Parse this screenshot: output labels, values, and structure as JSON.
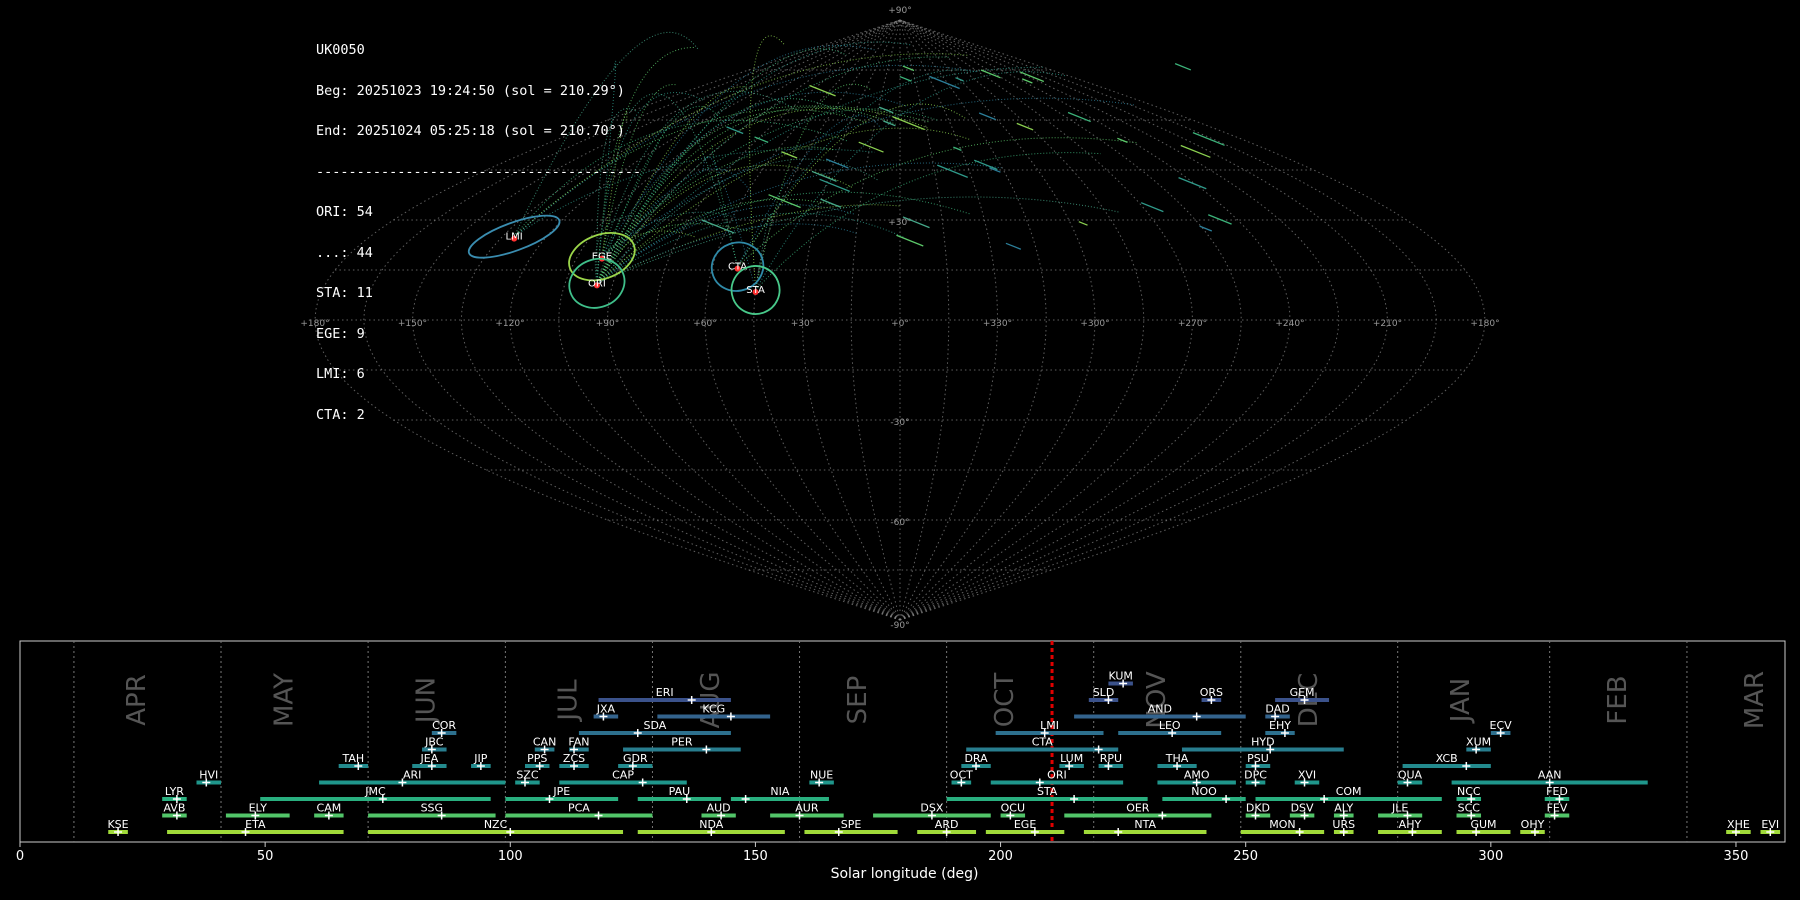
{
  "info": {
    "station": "UK0050",
    "begin": "Beg: 20251023 19:24:50 (sol = 210.29°)",
    "end": "End: 20251024 05:25:18 (sol = 210.70°)",
    "separator": "----------------------------------------",
    "counts": [
      "ORI: 54",
      "...: 44",
      "STA: 11",
      "EGE: 9",
      "LMI: 6",
      "CTA: 2"
    ]
  },
  "colors": {
    "background": "#000000",
    "grid": "#888888",
    "solar_marker": "#e00000",
    "text": "#ffffff",
    "month_label": "#555555"
  },
  "sky_map": {
    "projection": "sinusoidal",
    "lon_labels": [
      "+180°",
      "+150°",
      "+120°",
      "+90°",
      "+60°",
      "+30°",
      "+0°",
      "+330°",
      "+300°",
      "+270°",
      "+240°",
      "+210°",
      "+180°"
    ],
    "lat_labels": [
      "+90°",
      "+30°",
      "-30°",
      "-60°",
      "-90°"
    ],
    "radiants": [
      {
        "code": "LMI",
        "lon": 131,
        "lat": 25,
        "color": "#3a8db0",
        "a": 48,
        "b": 14
      },
      {
        "code": "EGE",
        "lon": 97,
        "lat": 19,
        "color": "#9bd64a",
        "a": 34,
        "b": 22
      },
      {
        "code": "ORI",
        "lon": 95,
        "lat": 11,
        "color": "#3fbf8a",
        "a": 28,
        "b": 24
      },
      {
        "code": "CTA",
        "lon": 52,
        "lat": 16,
        "color": "#2f8aa8",
        "a": 26,
        "b": 24
      },
      {
        "code": "STA",
        "lon": 45,
        "lat": 9,
        "color": "#48c98a",
        "a": 24,
        "b": 24
      }
    ]
  },
  "chart_data": {
    "type": "range-timeline",
    "xlabel": "Solar longitude (deg)",
    "xlim": [
      0,
      360
    ],
    "xticks": [
      "0",
      "50",
      "100",
      "150",
      "200",
      "250",
      "300",
      "350"
    ],
    "current_sol": 210.5,
    "months": [
      {
        "label": "APR",
        "pos": 24
      },
      {
        "label": "MAY",
        "pos": 54
      },
      {
        "label": "JUN",
        "pos": 83
      },
      {
        "label": "JUL",
        "pos": 112
      },
      {
        "label": "AUG",
        "pos": 141
      },
      {
        "label": "SEP",
        "pos": 171
      },
      {
        "label": "OCT",
        "pos": 201
      },
      {
        "label": "NOV",
        "pos": 232
      },
      {
        "label": "DEC",
        "pos": 263
      },
      {
        "label": "JAN",
        "pos": 294
      },
      {
        "label": "FEB",
        "pos": 326
      },
      {
        "label": "MAR",
        "pos": 354
      }
    ],
    "month_boundaries": [
      11,
      41,
      71,
      99,
      129,
      159,
      189,
      219,
      249,
      281,
      312,
      340
    ],
    "showers": [
      {
        "code": "KUM",
        "start": 222,
        "end": 227,
        "peak": 225,
        "row": 9,
        "color": "#3b528b"
      },
      {
        "code": "ERI",
        "start": 118,
        "end": 145,
        "peak": 137,
        "row": 8,
        "color": "#3b528b"
      },
      {
        "code": "SLD",
        "start": 218,
        "end": 224,
        "peak": 222,
        "row": 8,
        "color": "#3b528b"
      },
      {
        "code": "ORS",
        "start": 241,
        "end": 245,
        "peak": 243,
        "row": 8,
        "color": "#3b528b"
      },
      {
        "code": "GEM",
        "start": 256,
        "end": 267,
        "peak": 262,
        "row": 8,
        "color": "#3b528b"
      },
      {
        "code": "JXA",
        "start": 117,
        "end": 122,
        "peak": 119,
        "row": 7,
        "color": "#33638d"
      },
      {
        "code": "KCG",
        "start": 130,
        "end": 153,
        "peak": 145,
        "row": 7,
        "color": "#33638d"
      },
      {
        "code": "AND",
        "start": 215,
        "end": 250,
        "peak": 240,
        "row": 7,
        "color": "#33638d"
      },
      {
        "code": "DAD",
        "start": 254,
        "end": 259,
        "peak": 256,
        "row": 7,
        "color": "#33638d"
      },
      {
        "code": "COR",
        "start": 84,
        "end": 89,
        "peak": 86,
        "row": 6,
        "color": "#2d708e"
      },
      {
        "code": "SDA",
        "start": 114,
        "end": 145,
        "peak": 126,
        "row": 6,
        "color": "#2d708e"
      },
      {
        "code": "LMI",
        "start": 199,
        "end": 221,
        "peak": 209,
        "row": 6,
        "color": "#2d708e"
      },
      {
        "code": "LEO",
        "start": 224,
        "end": 245,
        "peak": 235,
        "row": 6,
        "color": "#2d708e"
      },
      {
        "code": "EHY",
        "start": 254,
        "end": 260,
        "peak": 258,
        "row": 6,
        "color": "#2d708e"
      },
      {
        "code": "ECV",
        "start": 300,
        "end": 304,
        "peak": 302,
        "row": 6,
        "color": "#2d708e"
      },
      {
        "code": "JBC",
        "start": 82,
        "end": 87,
        "peak": 84,
        "row": 5,
        "color": "#287d8e"
      },
      {
        "code": "CAN",
        "start": 105,
        "end": 109,
        "peak": 107,
        "row": 5,
        "color": "#287d8e"
      },
      {
        "code": "FAN",
        "start": 112,
        "end": 116,
        "peak": 113,
        "row": 5,
        "color": "#287d8e"
      },
      {
        "code": "PER",
        "start": 123,
        "end": 147,
        "peak": 140,
        "row": 5,
        "color": "#287d8e"
      },
      {
        "code": "CTA",
        "start": 193,
        "end": 224,
        "peak": 220,
        "row": 5,
        "color": "#287d8e"
      },
      {
        "code": "HYD",
        "start": 237,
        "end": 270,
        "peak": 255,
        "row": 5,
        "color": "#287d8e"
      },
      {
        "code": "XUM",
        "start": 295,
        "end": 300,
        "peak": 297,
        "row": 5,
        "color": "#287d8e"
      },
      {
        "code": "TAH",
        "start": 65,
        "end": 71,
        "peak": 69,
        "row": 4,
        "color": "#238a8d"
      },
      {
        "code": "JEA",
        "start": 80,
        "end": 87,
        "peak": 84,
        "row": 4,
        "color": "#238a8d"
      },
      {
        "code": "JIP",
        "start": 92,
        "end": 96,
        "peak": 94,
        "row": 4,
        "color": "#238a8d"
      },
      {
        "code": "PPS",
        "start": 103,
        "end": 108,
        "peak": 106,
        "row": 4,
        "color": "#238a8d"
      },
      {
        "code": "ZCS",
        "start": 110,
        "end": 116,
        "peak": 113,
        "row": 4,
        "color": "#238a8d"
      },
      {
        "code": "GDR",
        "start": 122,
        "end": 129,
        "peak": 125,
        "row": 4,
        "color": "#238a8d"
      },
      {
        "code": "DRA",
        "start": 192,
        "end": 198,
        "peak": 195,
        "row": 4,
        "color": "#238a8d"
      },
      {
        "code": "LUM",
        "start": 212,
        "end": 217,
        "peak": 214,
        "row": 4,
        "color": "#238a8d"
      },
      {
        "code": "RPU",
        "start": 220,
        "end": 225,
        "peak": 222,
        "row": 4,
        "color": "#238a8d"
      },
      {
        "code": "THA",
        "start": 232,
        "end": 240,
        "peak": 236,
        "row": 4,
        "color": "#238a8d"
      },
      {
        "code": "PSU",
        "start": 250,
        "end": 255,
        "peak": 252,
        "row": 4,
        "color": "#238a8d"
      },
      {
        "code": "XCB",
        "start": 282,
        "end": 300,
        "peak": 295,
        "row": 4,
        "color": "#238a8d"
      },
      {
        "code": "HVI",
        "start": 36,
        "end": 41,
        "peak": 38,
        "row": 3,
        "color": "#1f968b"
      },
      {
        "code": "ARI",
        "start": 61,
        "end": 99,
        "peak": 78,
        "row": 3,
        "color": "#1f968b"
      },
      {
        "code": "SZC",
        "start": 101,
        "end": 106,
        "peak": 103,
        "row": 3,
        "color": "#1f968b"
      },
      {
        "code": "CAP",
        "start": 110,
        "end": 136,
        "peak": 127,
        "row": 3,
        "color": "#1f968b"
      },
      {
        "code": "NUE",
        "start": 161,
        "end": 166,
        "peak": 163,
        "row": 3,
        "color": "#1f968b"
      },
      {
        "code": "OCT",
        "start": 190,
        "end": 194,
        "peak": 192,
        "row": 3,
        "color": "#1f968b"
      },
      {
        "code": "ORI",
        "start": 198,
        "end": 225,
        "peak": 208,
        "row": 3,
        "color": "#1f968b"
      },
      {
        "code": "AMO",
        "start": 232,
        "end": 248,
        "peak": 240,
        "row": 3,
        "color": "#1f968b"
      },
      {
        "code": "DPC",
        "start": 250,
        "end": 254,
        "peak": 252,
        "row": 3,
        "color": "#1f968b"
      },
      {
        "code": "XVI",
        "start": 260,
        "end": 265,
        "peak": 262,
        "row": 3,
        "color": "#1f968b"
      },
      {
        "code": "QUA",
        "start": 281,
        "end": 286,
        "peak": 283,
        "row": 3,
        "color": "#1f968b"
      },
      {
        "code": "AAN",
        "start": 292,
        "end": 332,
        "peak": 312,
        "row": 3,
        "color": "#1f968b"
      },
      {
        "code": "LYR",
        "start": 29,
        "end": 34,
        "peak": 32,
        "row": 2,
        "color": "#29af7f"
      },
      {
        "code": "JMC",
        "start": 49,
        "end": 96,
        "peak": 74,
        "row": 2,
        "color": "#29af7f"
      },
      {
        "code": "JPE",
        "start": 99,
        "end": 122,
        "peak": 108,
        "row": 2,
        "color": "#29af7f"
      },
      {
        "code": "PAU",
        "start": 126,
        "end": 143,
        "peak": 136,
        "row": 2,
        "color": "#29af7f"
      },
      {
        "code": "NIA",
        "start": 145,
        "end": 165,
        "peak": 148,
        "row": 2,
        "color": "#29af7f"
      },
      {
        "code": "STA",
        "start": 189,
        "end": 230,
        "peak": 215,
        "row": 2,
        "color": "#29af7f"
      },
      {
        "code": "NOO",
        "start": 233,
        "end": 250,
        "peak": 246,
        "row": 2,
        "color": "#29af7f"
      },
      {
        "code": "COM",
        "start": 252,
        "end": 290,
        "peak": 266,
        "row": 2,
        "color": "#29af7f"
      },
      {
        "code": "NCC",
        "start": 293,
        "end": 298,
        "peak": 296,
        "row": 2,
        "color": "#29af7f"
      },
      {
        "code": "FED",
        "start": 311,
        "end": 316,
        "peak": 314,
        "row": 2,
        "color": "#29af7f"
      },
      {
        "code": "AVB",
        "start": 29,
        "end": 34,
        "peak": 32,
        "row": 1,
        "color": "#52c569"
      },
      {
        "code": "ELY",
        "start": 42,
        "end": 55,
        "peak": 48,
        "row": 1,
        "color": "#52c569"
      },
      {
        "code": "CAM",
        "start": 60,
        "end": 66,
        "peak": 63,
        "row": 1,
        "color": "#52c569"
      },
      {
        "code": "SSG",
        "start": 71,
        "end": 97,
        "peak": 86,
        "row": 1,
        "color": "#52c569"
      },
      {
        "code": "PCA",
        "start": 99,
        "end": 129,
        "peak": 118,
        "row": 1,
        "color": "#52c569"
      },
      {
        "code": "AUD",
        "start": 139,
        "end": 146,
        "peak": 143,
        "row": 1,
        "color": "#52c569"
      },
      {
        "code": "AUR",
        "start": 153,
        "end": 168,
        "peak": 159,
        "row": 1,
        "color": "#52c569"
      },
      {
        "code": "DSX",
        "start": 174,
        "end": 198,
        "peak": 186,
        "row": 1,
        "color": "#52c569"
      },
      {
        "code": "OCU",
        "start": 200,
        "end": 205,
        "peak": 202,
        "row": 1,
        "color": "#52c569"
      },
      {
        "code": "OER",
        "start": 213,
        "end": 243,
        "peak": 233,
        "row": 1,
        "color": "#52c569"
      },
      {
        "code": "DKD",
        "start": 250,
        "end": 255,
        "peak": 252,
        "row": 1,
        "color": "#52c569"
      },
      {
        "code": "DSV",
        "start": 259,
        "end": 264,
        "peak": 262,
        "row": 1,
        "color": "#52c569"
      },
      {
        "code": "ALY",
        "start": 268,
        "end": 272,
        "peak": 270,
        "row": 1,
        "color": "#52c569"
      },
      {
        "code": "JLE",
        "start": 277,
        "end": 286,
        "peak": 283,
        "row": 1,
        "color": "#52c569"
      },
      {
        "code": "SCC",
        "start": 293,
        "end": 298,
        "peak": 296,
        "row": 1,
        "color": "#52c569"
      },
      {
        "code": "FEV",
        "start": 311,
        "end": 316,
        "peak": 313,
        "row": 1,
        "color": "#52c569"
      },
      {
        "code": "KSE",
        "start": 18,
        "end": 22,
        "peak": 20,
        "row": 0,
        "color": "#a0da39"
      },
      {
        "code": "ETA",
        "start": 30,
        "end": 66,
        "peak": 46,
        "row": 0,
        "color": "#a0da39"
      },
      {
        "code": "NZC",
        "start": 71,
        "end": 123,
        "peak": 100,
        "row": 0,
        "color": "#a0da39"
      },
      {
        "code": "NDA",
        "start": 126,
        "end": 156,
        "peak": 141,
        "row": 0,
        "color": "#a0da39"
      },
      {
        "code": "SPE",
        "start": 160,
        "end": 179,
        "peak": 167,
        "row": 0,
        "color": "#a0da39"
      },
      {
        "code": "ARD",
        "start": 183,
        "end": 195,
        "peak": 189,
        "row": 0,
        "color": "#a0da39"
      },
      {
        "code": "EGE",
        "start": 197,
        "end": 213,
        "peak": 207,
        "row": 0,
        "color": "#a0da39"
      },
      {
        "code": "NTA",
        "start": 217,
        "end": 242,
        "peak": 224,
        "row": 0,
        "color": "#a0da39"
      },
      {
        "code": "MON",
        "start": 249,
        "end": 266,
        "peak": 261,
        "row": 0,
        "color": "#a0da39"
      },
      {
        "code": "URS",
        "start": 268,
        "end": 272,
        "peak": 270,
        "row": 0,
        "color": "#a0da39"
      },
      {
        "code": "AHY",
        "start": 277,
        "end": 290,
        "peak": 284,
        "row": 0,
        "color": "#a0da39"
      },
      {
        "code": "GUM",
        "start": 293,
        "end": 304,
        "peak": 297,
        "row": 0,
        "color": "#a0da39"
      },
      {
        "code": "OHY",
        "start": 306,
        "end": 311,
        "peak": 309,
        "row": 0,
        "color": "#a0da39"
      },
      {
        "code": "XHE",
        "start": 348,
        "end": 353,
        "peak": 350,
        "row": 0,
        "color": "#a0da39"
      },
      {
        "code": "EVI",
        "start": 355,
        "end": 359,
        "peak": 357,
        "row": 0,
        "color": "#a0da39"
      }
    ]
  }
}
